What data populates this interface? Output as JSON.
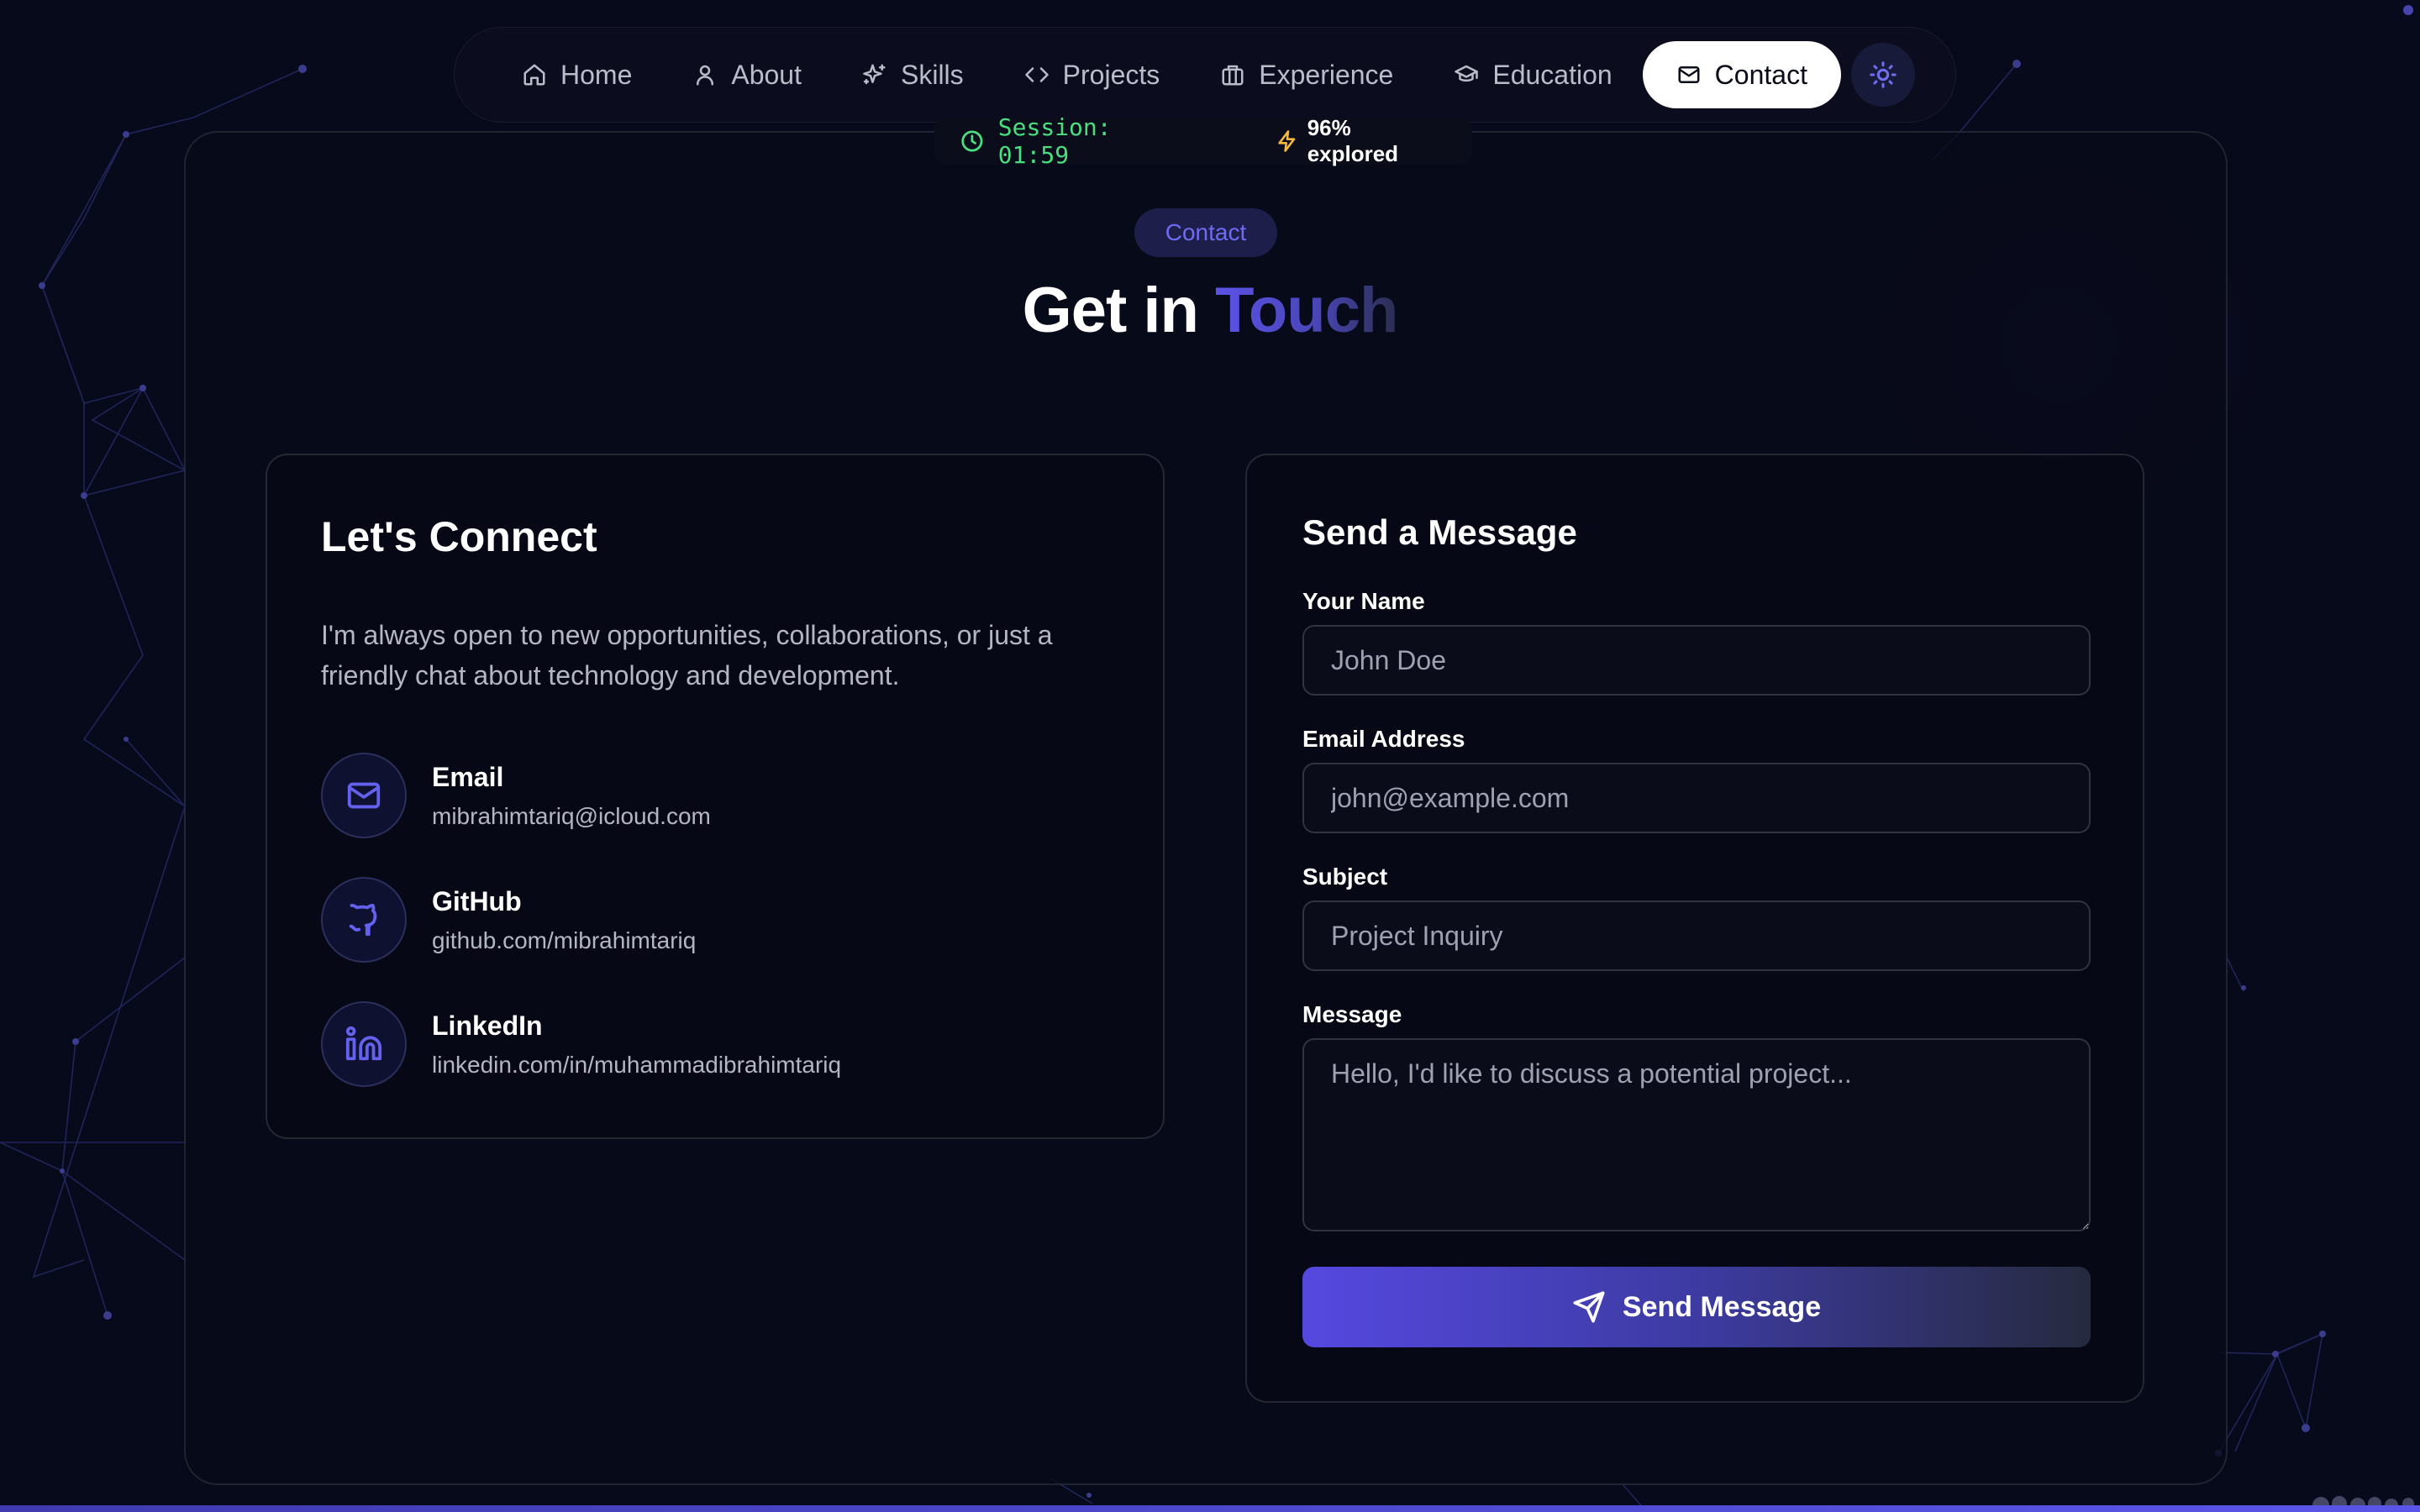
{
  "nav": {
    "items": [
      {
        "label": "Home",
        "icon": "home-icon"
      },
      {
        "label": "About",
        "icon": "user-icon"
      },
      {
        "label": "Skills",
        "icon": "sparkles-icon"
      },
      {
        "label": "Projects",
        "icon": "code-icon"
      },
      {
        "label": "Experience",
        "icon": "briefcase-icon"
      },
      {
        "label": "Education",
        "icon": "graduation-cap-icon"
      },
      {
        "label": "Contact",
        "icon": "mail-icon",
        "active": true
      }
    ],
    "theme_icon": "sun-icon"
  },
  "status": {
    "session": "Session: 01:59",
    "explored": "96% explored"
  },
  "section": {
    "badge": "Contact",
    "title_main": "Get in ",
    "title_accent": "Touch"
  },
  "connect": {
    "title": "Let's Connect",
    "description": "I'm always open to new opportunities, collaborations, or just a friendly chat about technology and development.",
    "items": [
      {
        "label": "Email",
        "value": "mibrahimtariq@icloud.com",
        "icon": "mail-icon"
      },
      {
        "label": "GitHub",
        "value": "github.com/mibrahimtariq",
        "icon": "github-icon"
      },
      {
        "label": "LinkedIn",
        "value": "linkedin.com/in/muhammadibrahimtariq",
        "icon": "linkedin-icon"
      }
    ]
  },
  "form": {
    "title": "Send a Message",
    "name_label": "Your Name",
    "name_placeholder": "John Doe",
    "email_label": "Email Address",
    "email_placeholder": "john@example.com",
    "subject_label": "Subject",
    "subject_placeholder": "Project Inquiry",
    "message_label": "Message",
    "message_placeholder": "Hello, I'd like to discuss a potential project...",
    "submit_label": "Send Message"
  },
  "colors": {
    "accent": "#5b52e6",
    "background": "#070a1a",
    "session_green": "#4ade80",
    "bolt_yellow": "#f5b83b"
  }
}
